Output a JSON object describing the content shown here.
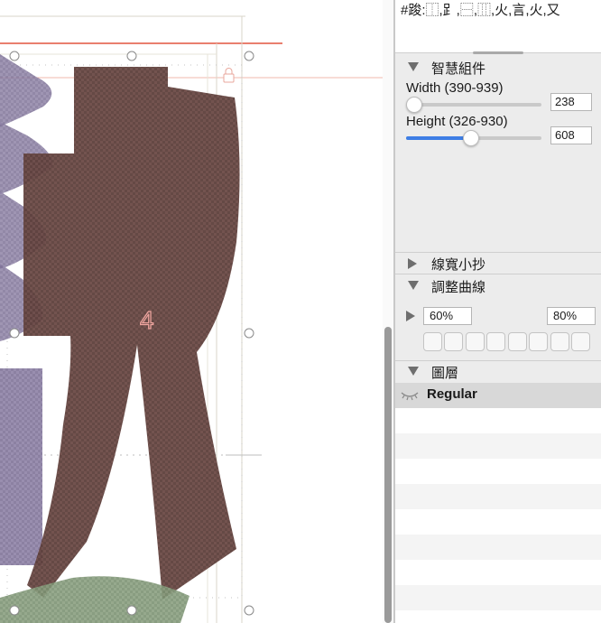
{
  "glyph_info": {
    "text": "#踆:⿰,⻊,⿱,⿲,火,言,火,又"
  },
  "smart_components": {
    "title": "智慧組件",
    "width": {
      "label": "Width (390-939)",
      "value": "238",
      "min": 390,
      "max": 939,
      "fraction": 0.0
    },
    "height": {
      "label": "Height (326-930)",
      "value": "608",
      "min": 326,
      "max": 930,
      "fraction": 0.47
    }
  },
  "line_width_cheatsheet": {
    "title": "線寬小抄"
  },
  "adjust_curves": {
    "title": "調整曲線",
    "left_value": "60%",
    "right_value": "80%",
    "presets": [
      "",
      "",
      "",
      "",
      "",
      "",
      "",
      ""
    ]
  },
  "layers": {
    "title": "圖層",
    "items": [
      {
        "name": "Regular",
        "icon": "eye-closed-icon",
        "selected": true
      }
    ]
  },
  "canvas": {
    "component_index": "4"
  },
  "colors": {
    "accent": "#3e7ee5",
    "brown_fill": "#6b4a46",
    "purple_fill": "#8c7fa3",
    "green_fill": "#8aa07f",
    "red_guide": "#e2553e"
  }
}
